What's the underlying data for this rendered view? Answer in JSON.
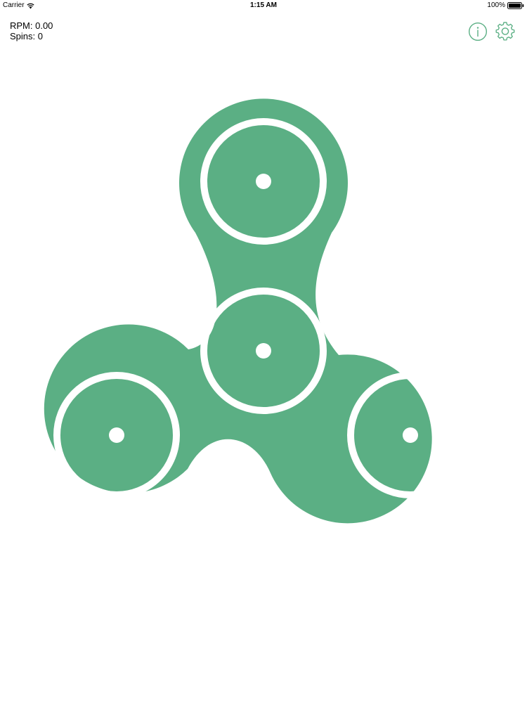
{
  "status_bar": {
    "carrier": "Carrier",
    "time": "1:15 AM",
    "battery": "100%"
  },
  "stats": {
    "rpm": "RPM: 0.00",
    "spins": "Spins: 0"
  },
  "icons": {
    "info": "info-icon",
    "settings": "gear-icon",
    "wifi": "wifi-icon",
    "battery": "battery-icon"
  },
  "colors": {
    "spinner_body": "#5BAF84",
    "spinner_ring": "#FFFFFF",
    "icon_accent": "#5BAF84"
  }
}
